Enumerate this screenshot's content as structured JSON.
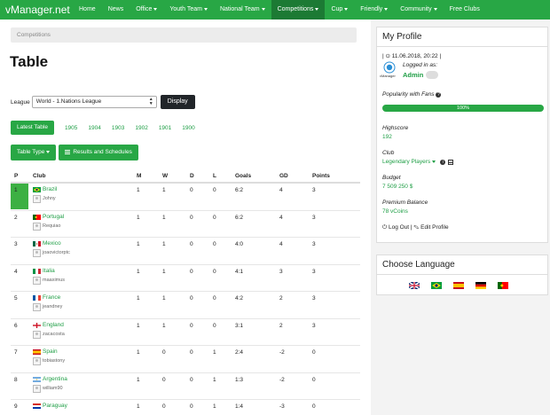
{
  "brand": "vManager.net",
  "nav": [
    {
      "label": "Home",
      "dropdown": false,
      "active": false
    },
    {
      "label": "News",
      "dropdown": false,
      "active": false
    },
    {
      "label": "Office",
      "dropdown": true,
      "active": false
    },
    {
      "label": "Youth Team",
      "dropdown": true,
      "active": false
    },
    {
      "label": "National Team",
      "dropdown": true,
      "active": false
    },
    {
      "label": "Competitions",
      "dropdown": true,
      "active": true
    },
    {
      "label": "Cup",
      "dropdown": true,
      "active": false
    },
    {
      "label": "Friendly",
      "dropdown": true,
      "active": false
    },
    {
      "label": "Community",
      "dropdown": true,
      "active": false
    },
    {
      "label": "Free Clubs",
      "dropdown": false,
      "active": false
    }
  ],
  "breadcrumb": "Competitions",
  "page_title": "Table",
  "league": {
    "label": "League",
    "selected": "World - 1.Nations League",
    "display_button": "Display"
  },
  "seasons": {
    "latest": "Latest Table",
    "years": [
      "1905",
      "1904",
      "1903",
      "1902",
      "1901",
      "1900"
    ]
  },
  "actions": {
    "table_type": "Table Type",
    "results": "Results and Schedules"
  },
  "table": {
    "headers": {
      "p": "P",
      "club": "Club",
      "m": "M",
      "w": "W",
      "d": "D",
      "l": "L",
      "goals": "Goals",
      "gd": "GD",
      "points": "Points"
    },
    "rows": [
      {
        "p": "1",
        "team": "Brazil",
        "user": "Johny",
        "flag": "brazil",
        "m": "1",
        "w": "1",
        "d": "0",
        "l": "0",
        "goals": "6:2",
        "gd": "4",
        "points": "3"
      },
      {
        "p": "2",
        "team": "Portugal",
        "user": "Requiao",
        "flag": "portugal",
        "m": "1",
        "w": "1",
        "d": "0",
        "l": "0",
        "goals": "6:2",
        "gd": "4",
        "points": "3"
      },
      {
        "p": "3",
        "team": "Mexico",
        "user": "joaovictorptc",
        "flag": "mexico",
        "m": "1",
        "w": "1",
        "d": "0",
        "l": "0",
        "goals": "4:0",
        "gd": "4",
        "points": "3"
      },
      {
        "p": "4",
        "team": "Italia",
        "user": "maaximus",
        "flag": "italy",
        "m": "1",
        "w": "1",
        "d": "0",
        "l": "0",
        "goals": "4:1",
        "gd": "3",
        "points": "3"
      },
      {
        "p": "5",
        "team": "France",
        "user": "jeandney",
        "flag": "france",
        "m": "1",
        "w": "1",
        "d": "0",
        "l": "0",
        "goals": "4:2",
        "gd": "2",
        "points": "3"
      },
      {
        "p": "6",
        "team": "England",
        "user": "zacacosta",
        "flag": "england",
        "m": "1",
        "w": "1",
        "d": "0",
        "l": "0",
        "goals": "3:1",
        "gd": "2",
        "points": "3"
      },
      {
        "p": "7",
        "team": "Spain",
        "user": "tobiastony",
        "flag": "spain",
        "m": "1",
        "w": "0",
        "d": "0",
        "l": "1",
        "goals": "2:4",
        "gd": "-2",
        "points": "0"
      },
      {
        "p": "8",
        "team": "Argentina",
        "user": "william90",
        "flag": "argentina",
        "m": "1",
        "w": "0",
        "d": "0",
        "l": "1",
        "goals": "1:3",
        "gd": "-2",
        "points": "0"
      },
      {
        "p": "9",
        "team": "Paraguay",
        "user": "",
        "flag": "paraguay",
        "m": "1",
        "w": "0",
        "d": "0",
        "l": "1",
        "goals": "1:4",
        "gd": "-3",
        "points": "0"
      }
    ]
  },
  "profile": {
    "title": "My Profile",
    "datetime": "| ⊙ 11.06.2018, 20:22 |",
    "logged_in_as": "Logged in as:",
    "username": "Admin",
    "badge_caption": "vManager",
    "popularity_label": "Popularity with Fans",
    "popularity_value": "100%",
    "popularity_fraction": 1.0,
    "highscore_label": "Highscore",
    "highscore_value": "192",
    "club_label": "Club",
    "club_value": "Legendary Players",
    "budget_label": "Budget",
    "budget_value": "7 509 250 $",
    "premium_label": "Premium Balance",
    "premium_value": "78 vCoins",
    "logout": "Log Out",
    "edit": "Edit Profile"
  },
  "language": {
    "title": "Choose Language",
    "flags": [
      "united-kingdom",
      "brazil",
      "spain",
      "germany",
      "portugal"
    ]
  }
}
